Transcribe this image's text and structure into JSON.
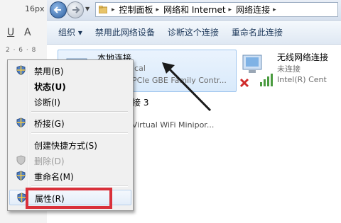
{
  "background_app": {
    "font_size": "16px",
    "underline_btn": "U",
    "font_color_btn": "A",
    "ruler_marks": "2 · 6 · 8"
  },
  "window": {
    "breadcrumb": [
      "控制面板",
      "网络和 Internet",
      "网络连接"
    ],
    "toolbar": [
      "组织 ▾",
      "禁用此网络设备",
      "诊断这个连接",
      "重命名此连接"
    ]
  },
  "connections": {
    "local": {
      "name": "本地连接",
      "status": "ical",
      "adapter": "PCIe GBE Family Contr..."
    },
    "wireless": {
      "name": "无线网络连接",
      "status": "未连接",
      "adapter": "Intel(R) Cent"
    },
    "local3": {
      "name": "接 3",
      "adapter": "t Virtual WiFi Minipor..."
    }
  },
  "context_menu": {
    "items": [
      {
        "label": "禁用(B)"
      },
      {
        "label": "状态(U)"
      },
      {
        "label": "诊断(I)"
      },
      {
        "label": "桥接(G)"
      },
      {
        "label": "创建快捷方式(S)"
      },
      {
        "label": "删除(D)"
      },
      {
        "label": "重命名(M)"
      },
      {
        "label": "属性(R)"
      }
    ]
  },
  "colors": {
    "highlight": "#d9303a",
    "arrow": "#1a1a1a",
    "selection": "#d9eafb"
  }
}
